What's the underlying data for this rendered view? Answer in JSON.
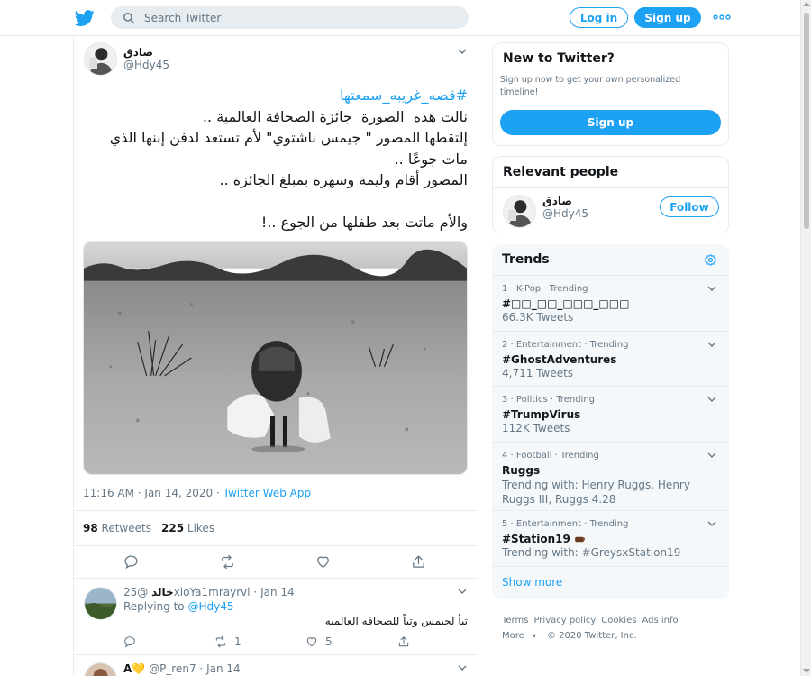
{
  "header": {
    "search_placeholder": "Search Twitter",
    "login_label": "Log in",
    "signup_label": "Sign up"
  },
  "tweet": {
    "author_name": "صادق",
    "author_handle": "@Hdy45",
    "hashtag": "#قصه_غريبه_سمعتها",
    "body": "نالت هذه  الصورة  جائزة الصحافة العالمية ..\nإلتقطها المصور \" جيمس ناشتوي\" لأم تستعد لدفن إبنها الذي مات جوعًا ..\nالمصور أقام وليمة وسهرة بمبلغ الجائزة ..\n\nوالأم ماتت بعد طفلها من الجوع ..!",
    "time": "11:16 AM · Jan 14, 2020",
    "separator": " · ",
    "source": "Twitter Web App",
    "retweets_count": "98",
    "retweets_label": "Retweets",
    "likes_count": "225",
    "likes_label": "Likes"
  },
  "replies": [
    {
      "author_name": "خالد",
      "author_handle": "@25xioYa1mrayrvl",
      "date": "Jan 14",
      "replying_prefix": "Replying to ",
      "replying_to": "@Hdy45",
      "text": "تبأ لجيمس وتباً للصحافه العالميه",
      "retweets": "1",
      "likes": "5"
    },
    {
      "author_name": "A💛",
      "author_handle": "@P_ren7",
      "date": "Jan 14"
    }
  ],
  "sidebar": {
    "new_title": "New to Twitter?",
    "new_text": "Sign up now to get your own personalized timeline!",
    "new_signup": "Sign up",
    "relevant_title": "Relevant people",
    "person_name": "صادق",
    "person_handle": "@Hdy45",
    "follow_label": "Follow",
    "trends_title": "Trends",
    "trends": [
      {
        "meta": "1 · K-Pop · Trending",
        "name": "#□□_□□_□□□_□□□",
        "count": "66.3K Tweets"
      },
      {
        "meta": "2 · Entertainment · Trending",
        "name": "#GhostAdventures",
        "count": "4,711 Tweets"
      },
      {
        "meta": "3 · Politics · Trending",
        "name": "#TrumpVirus",
        "count": "112K Tweets"
      },
      {
        "meta": "4 · Football · Trending",
        "name": "Ruggs",
        "count": "Trending with: Henry Ruggs, Henry Ruggs III, Ruggs 4.28"
      },
      {
        "meta": "5 · Entertainment · Trending",
        "name": "#Station19",
        "count": "Trending with: #GreysxStation19"
      }
    ],
    "show_more": "Show more",
    "footer": [
      "Terms",
      "Privacy policy",
      "Cookies",
      "Ads info",
      "More",
      "© 2020 Twitter, Inc."
    ]
  },
  "colors": {
    "accent": "#1da1f2",
    "secondary_text": "#657786",
    "border": "#e6ecf0",
    "panel_bg": "#f5f8fa"
  }
}
